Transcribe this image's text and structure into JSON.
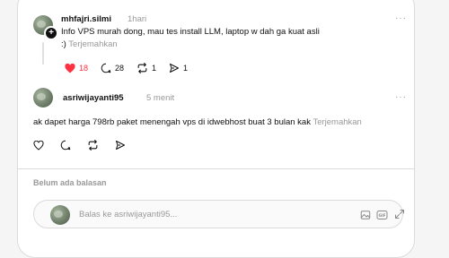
{
  "thread": {
    "original_post": {
      "username": "mhfajri.silmi",
      "time": "1hari",
      "text": "Info VPS murah dong, mau tes install LLM, laptop w dah ga kuat asli",
      "text_line2": ":)",
      "translate_label": "Terjemahkan",
      "more_label": "···",
      "likes": "18",
      "comments": "28",
      "reposts": "1",
      "shares": "1"
    },
    "reply_post": {
      "username": "asriwijayanti95",
      "time": "5 menit",
      "text": "ak dapet harga 798rb paket menengah vps di idwebhost buat 3 bulan kak",
      "translate_label": "Terjemahkan",
      "more_label": "···"
    }
  },
  "replies_section": {
    "empty_label": "Belum ada balasan"
  },
  "reply_composer": {
    "placeholder": "Balas ke asriwijayanti95..."
  },
  "colors": {
    "like_active": "#ff3040",
    "muted_text": "#999999",
    "border": "#dbdbdb"
  }
}
